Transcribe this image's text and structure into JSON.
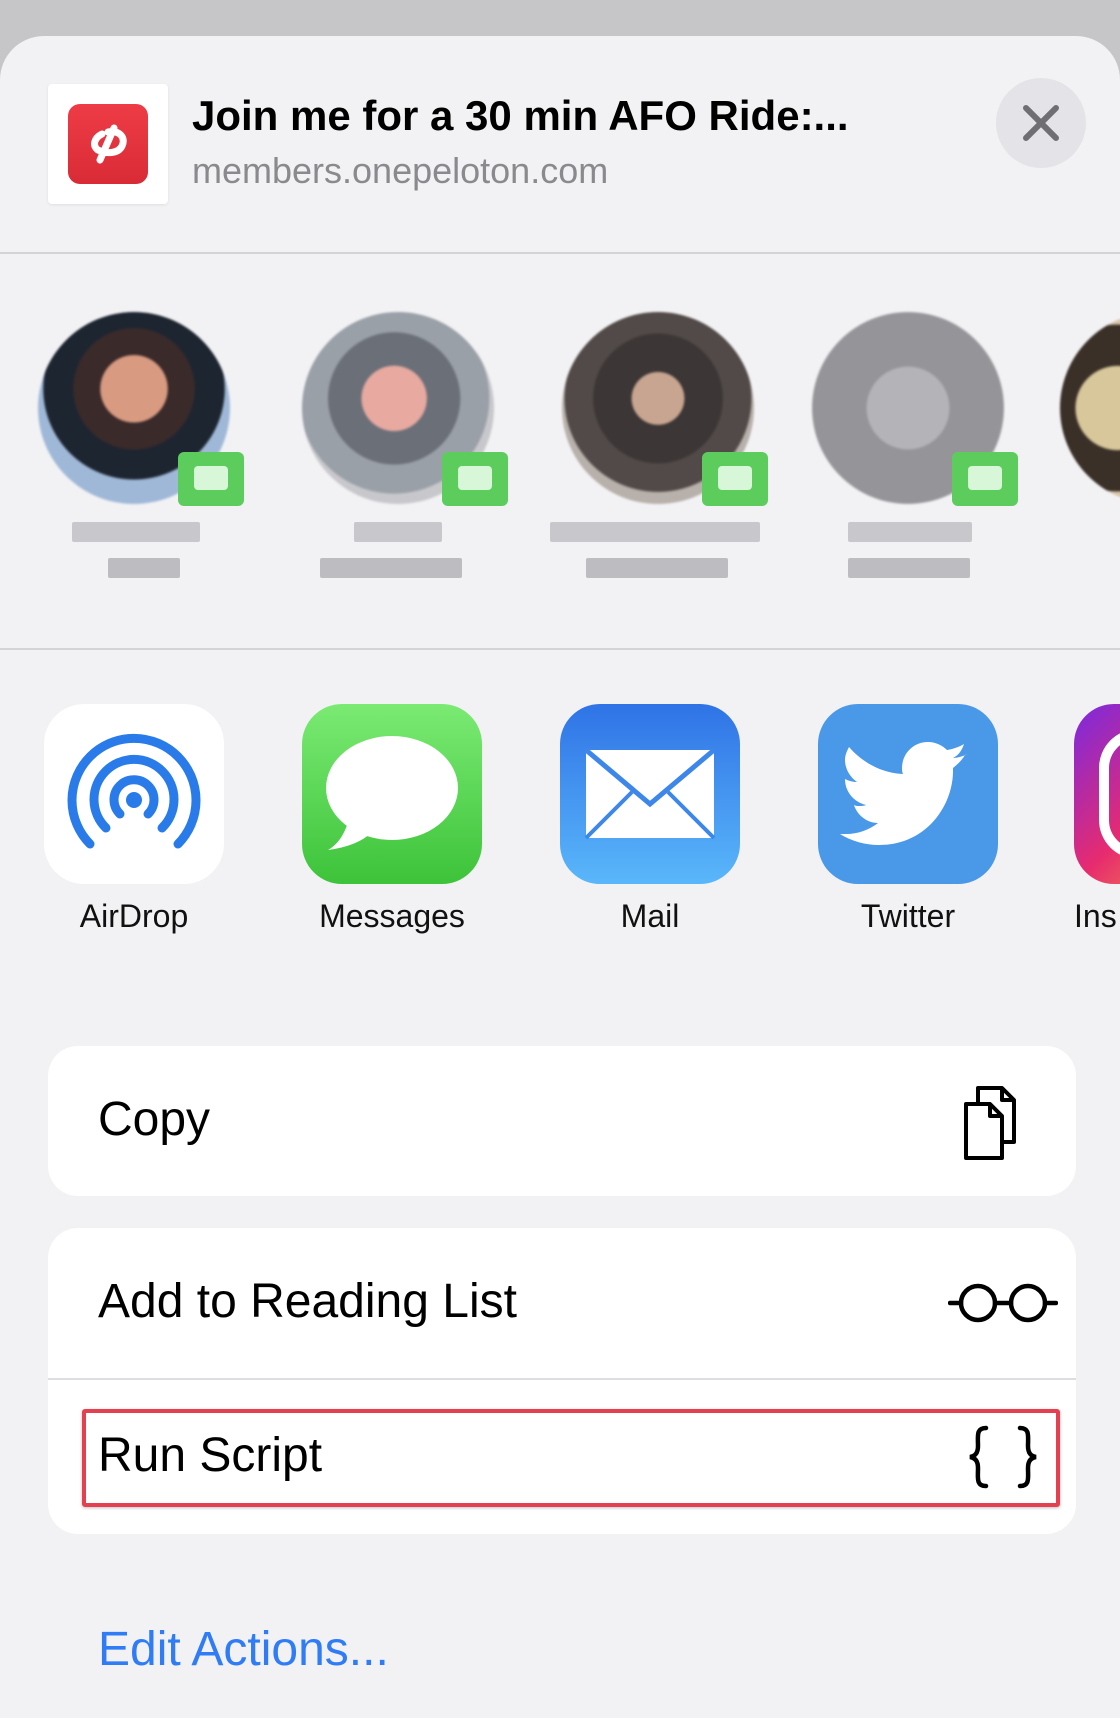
{
  "header": {
    "title": "Join me for a 30 min AFO Ride:...",
    "url": "members.onepeloton.com",
    "logo_color": "#e5323c",
    "close_icon": "close-icon"
  },
  "people": [
    {
      "name_line1": "",
      "name_line2": ""
    },
    {
      "name_line1": "",
      "name_line2": ""
    },
    {
      "name_line1": "",
      "name_line2": ""
    },
    {
      "name_line1": "",
      "name_line2": ""
    },
    {
      "name_line1": "",
      "name_line2": ""
    }
  ],
  "apps": [
    {
      "label": "AirDrop",
      "icon": "airdrop-icon"
    },
    {
      "label": "Messages",
      "icon": "messages-icon"
    },
    {
      "label": "Mail",
      "icon": "mail-icon"
    },
    {
      "label": "Twitter",
      "icon": "twitter-icon"
    },
    {
      "label": "Ins",
      "icon": "instagram-icon"
    }
  ],
  "actions": {
    "copy": {
      "label": "Copy",
      "icon": "copy-icon"
    },
    "reading_list": {
      "label": "Add to Reading List",
      "icon": "glasses-icon"
    },
    "run_script": {
      "label": "Run Script",
      "icon": "curly-braces-icon"
    }
  },
  "edit_actions": {
    "label": "Edit Actions..."
  },
  "colors": {
    "accent": "#2f7cf6",
    "highlight": "#e54050",
    "sheet_bg": "#f2f2f4"
  }
}
